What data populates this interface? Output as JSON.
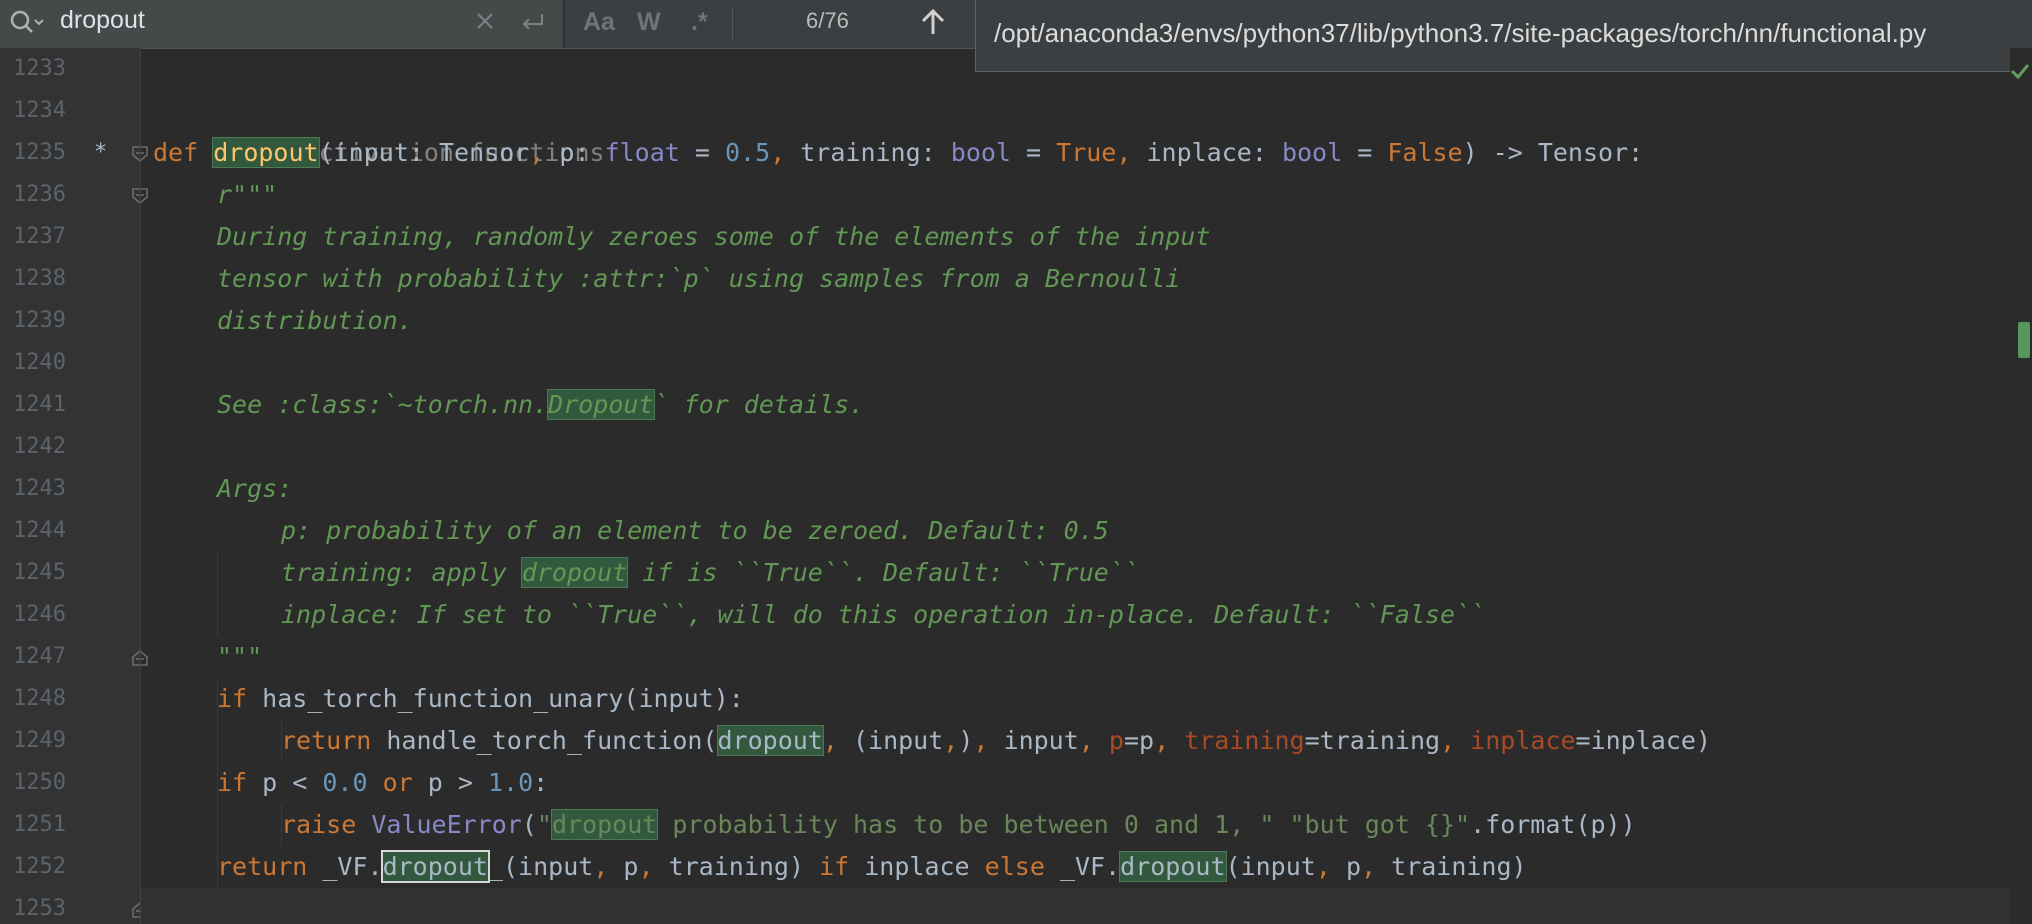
{
  "find": {
    "query": "dropout",
    "match_count": "6/76",
    "opt_case": "Aa",
    "opt_word": "W",
    "opt_regex": ".*"
  },
  "tooltip": {
    "path": "/opt/anaconda3/envs/python37/lib/python3.7/site-packages/torch/nn/functional.py"
  },
  "editor": {
    "line_numbers": [
      "1233",
      "1234",
      "1235",
      "1236",
      "1237",
      "1238",
      "1239",
      "1240",
      "1241",
      "1242",
      "1243",
      "1244",
      "1245",
      "1246",
      "1247",
      "1248",
      "1249",
      "1250",
      "1251",
      "1252",
      "1253"
    ],
    "modified_marker": "*",
    "lines": {
      "l1234": "# Activation functions",
      "l1235_def": "def ",
      "l1235_name": "dropout",
      "l1235_a": "(input: Tensor",
      "l1235_b": ", ",
      "l1235_c": "p: ",
      "l1235_float": "float",
      "l1235_d": " = ",
      "l1235_num": "0.5",
      "l1235_e": ", ",
      "l1235_f": "training: ",
      "l1235_bool1": "bool",
      "l1235_g": " = ",
      "l1235_true": "True",
      "l1235_h": ", ",
      "l1235_i": "inplace: ",
      "l1235_bool2": "bool",
      "l1235_j": " = ",
      "l1235_false": "False",
      "l1235_k": ") -> Tensor:",
      "l1236": "r\"\"\"",
      "l1237": "During training, randomly zeroes some of the elements of the input",
      "l1238": "tensor with probability :attr:`p` using samples from a Bernoulli",
      "l1239": "distribution.",
      "l1241_a": "See :class:`~torch.nn.",
      "l1241_hl": "Dropout",
      "l1241_b": "` for details.",
      "l1243": "Args:",
      "l1244": "p: probability of an element to be zeroed. Default: 0.5",
      "l1245_a": "training: apply ",
      "l1245_hl": "dropout",
      "l1245_b": " if is ``True``. Default: ``True``",
      "l1246": "inplace: If set to ``True``, will do this operation in-place. Default: ``False``",
      "l1247": "\"\"\"",
      "l1248_kw": "if ",
      "l1248_rest": "has_torch_function_unary(input):",
      "l1249_kw": "return ",
      "l1249_a": "handle_torch_function(",
      "l1249_hl": "dropout",
      "l1249_c1": ", ",
      "l1249_b": "(input",
      "l1249_c2": ",",
      "l1249_c": ")",
      "l1249_c3": ", ",
      "l1249_d": "input",
      "l1249_c4": ", ",
      "l1249_k1": "p",
      "l1249_e": "=p",
      "l1249_c5": ", ",
      "l1249_k2": "training",
      "l1249_f": "=training",
      "l1249_c6": ", ",
      "l1249_k3": "inplace",
      "l1249_g": "=inplace)",
      "l1250_kw": "if ",
      "l1250_a": "p < ",
      "l1250_n1": "0.0",
      "l1250_or": " or ",
      "l1250_b": "p > ",
      "l1250_n2": "1.0",
      "l1250_c": ":",
      "l1251_kw": "raise ",
      "l1251_err": "ValueError",
      "l1251_a": "(",
      "l1251_q": "\"",
      "l1251_hl": "dropout",
      "l1251_s": " probability has to be between 0 and 1, \" \"but got {}\"",
      "l1251_b": ".format(p))",
      "l1252_kw": "return ",
      "l1252_a": "_VF.",
      "l1252_hl1": "dropout",
      "l1252_b": "_(input",
      "l1252_c1": ", ",
      "l1252_c": "p",
      "l1252_c2": ", ",
      "l1252_d": "training) ",
      "l1252_if": "if ",
      "l1252_e": "inplace ",
      "l1252_else": "else ",
      "l1252_f": "_VF.",
      "l1252_hl2": "dropout",
      "l1252_g": "(input",
      "l1252_c3": ", ",
      "l1252_h": "p",
      "l1252_c4": ", ",
      "l1252_i": "training)"
    }
  },
  "colors": {
    "keyword": "#cc7832",
    "number": "#6897bb",
    "builtin": "#8888c6",
    "docstring": "#629755",
    "string": "#6a8759",
    "kwarg": "#aa4926",
    "match_highlight": "#32593d"
  },
  "icons": [
    "search-icon",
    "clear-icon",
    "regex-newline-icon",
    "arrow-up-icon",
    "fold-icon",
    "check-icon"
  ]
}
